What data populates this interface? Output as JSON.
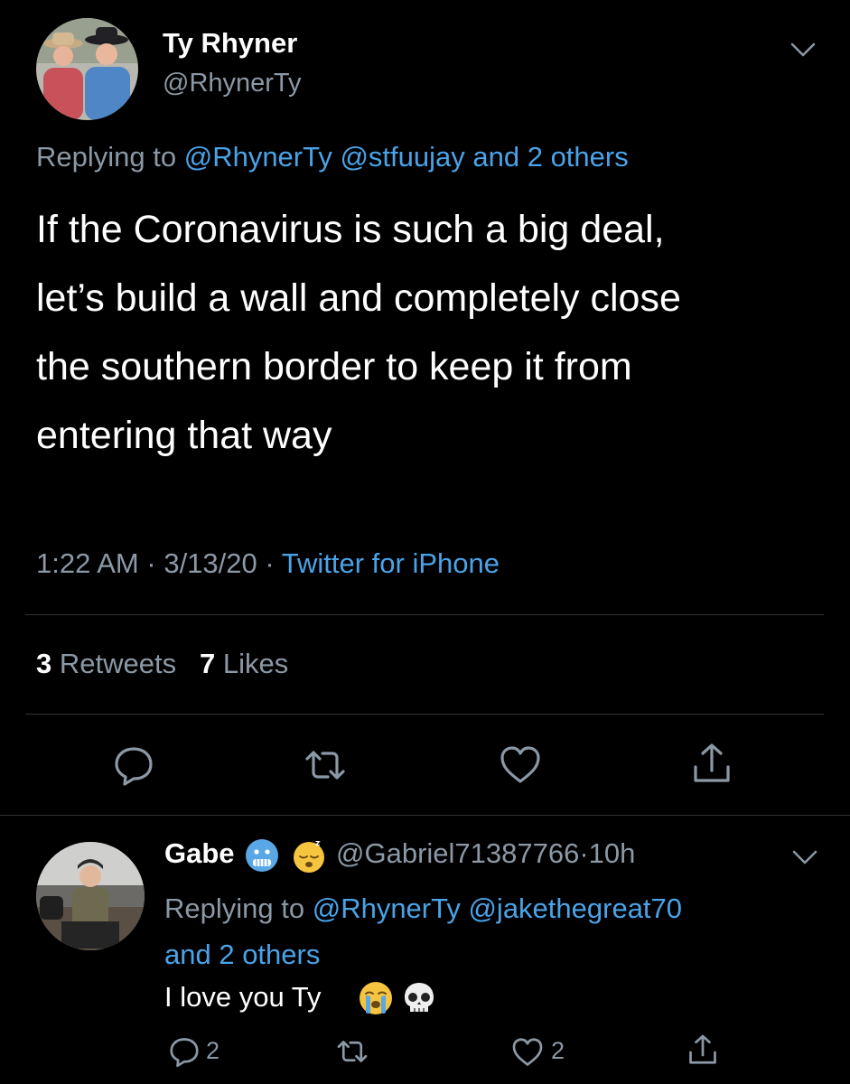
{
  "main_tweet": {
    "display_name": "Ty Rhyner",
    "handle": "@RhynerTy",
    "replying_prefix": "Replying to",
    "replying_mentions": "@RhynerTy @stfuujay and 2 others",
    "text": "If the Coronavirus is such a big deal,\nlet’s build a wall and completely close\nthe southern border to keep it from\nentering that way",
    "time": "1:22 AM",
    "separator": "·",
    "date": "3/13/20",
    "source": "Twitter for iPhone",
    "retweets_count": "3",
    "retweets_label": "Retweets",
    "likes_count": "7",
    "likes_label": "Likes"
  },
  "reply_tweet": {
    "display_name": "Gabe",
    "emoji_1": "cold-face-emoji",
    "emoji_2": "sleeping-face-emoji",
    "handle": "@Gabriel71387766",
    "separator": "·",
    "time_ago": "10h",
    "replying_prefix": "Replying to",
    "replying_mentions_1": "@RhynerTy @jakethegreat70",
    "replying_mentions_2": "and 2 others",
    "text": "I love you Ty",
    "text_emoji_1": "crying-face-emoji",
    "text_emoji_2": "skull-emoji",
    "reply_count": "2",
    "like_count": "2"
  },
  "colors": {
    "background": "#000000",
    "text": "#ffffff",
    "secondary": "#8b98a5",
    "link": "#4aa3e8",
    "divider": "#2f3336"
  }
}
